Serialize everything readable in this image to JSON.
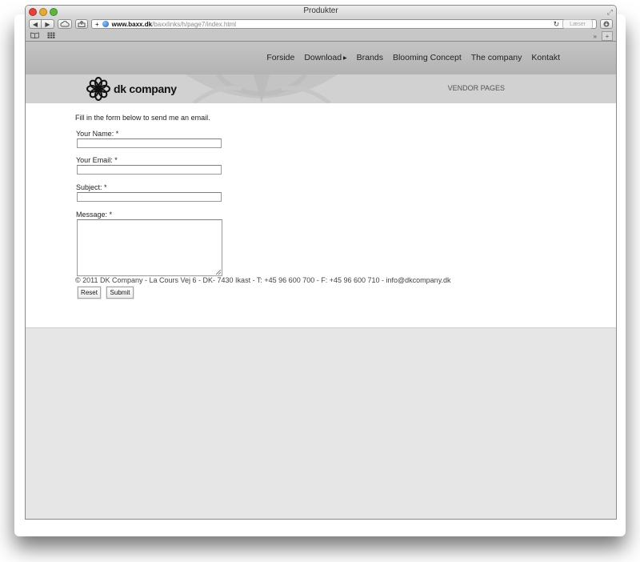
{
  "browser": {
    "window_title": "Produkter",
    "url_domain": "www.baxx.dk",
    "url_path": "/baxxlinks/h/page7/index.html",
    "reader_label": "Læser",
    "overflow_label": "»",
    "new_tab_label": "+",
    "add_label": "+"
  },
  "site": {
    "menu": [
      "Forside",
      "Download",
      "Brands",
      "Blooming Concept",
      "The company",
      "Kontakt"
    ],
    "logo_text": "dk company",
    "vendor_pages": "VENDOR PAGES"
  },
  "form": {
    "intro": "Fill in the form below to send me an email.",
    "name_label": "Your Name: *",
    "name_value": "",
    "email_label": "Your Email: *",
    "email_value": "",
    "subject_label": "Subject: *",
    "subject_value": "",
    "message_label": "Message: *",
    "message_value": "",
    "reset_label": "Reset",
    "submit_label": "Submit"
  },
  "footer": {
    "text": "© 2011 DK Company  -  La Cours Vej 6  -  DK- 7430 Ikast - T: +45 96 600 700  - F: +45 96 600 710 - info@dkcompany.dk"
  }
}
